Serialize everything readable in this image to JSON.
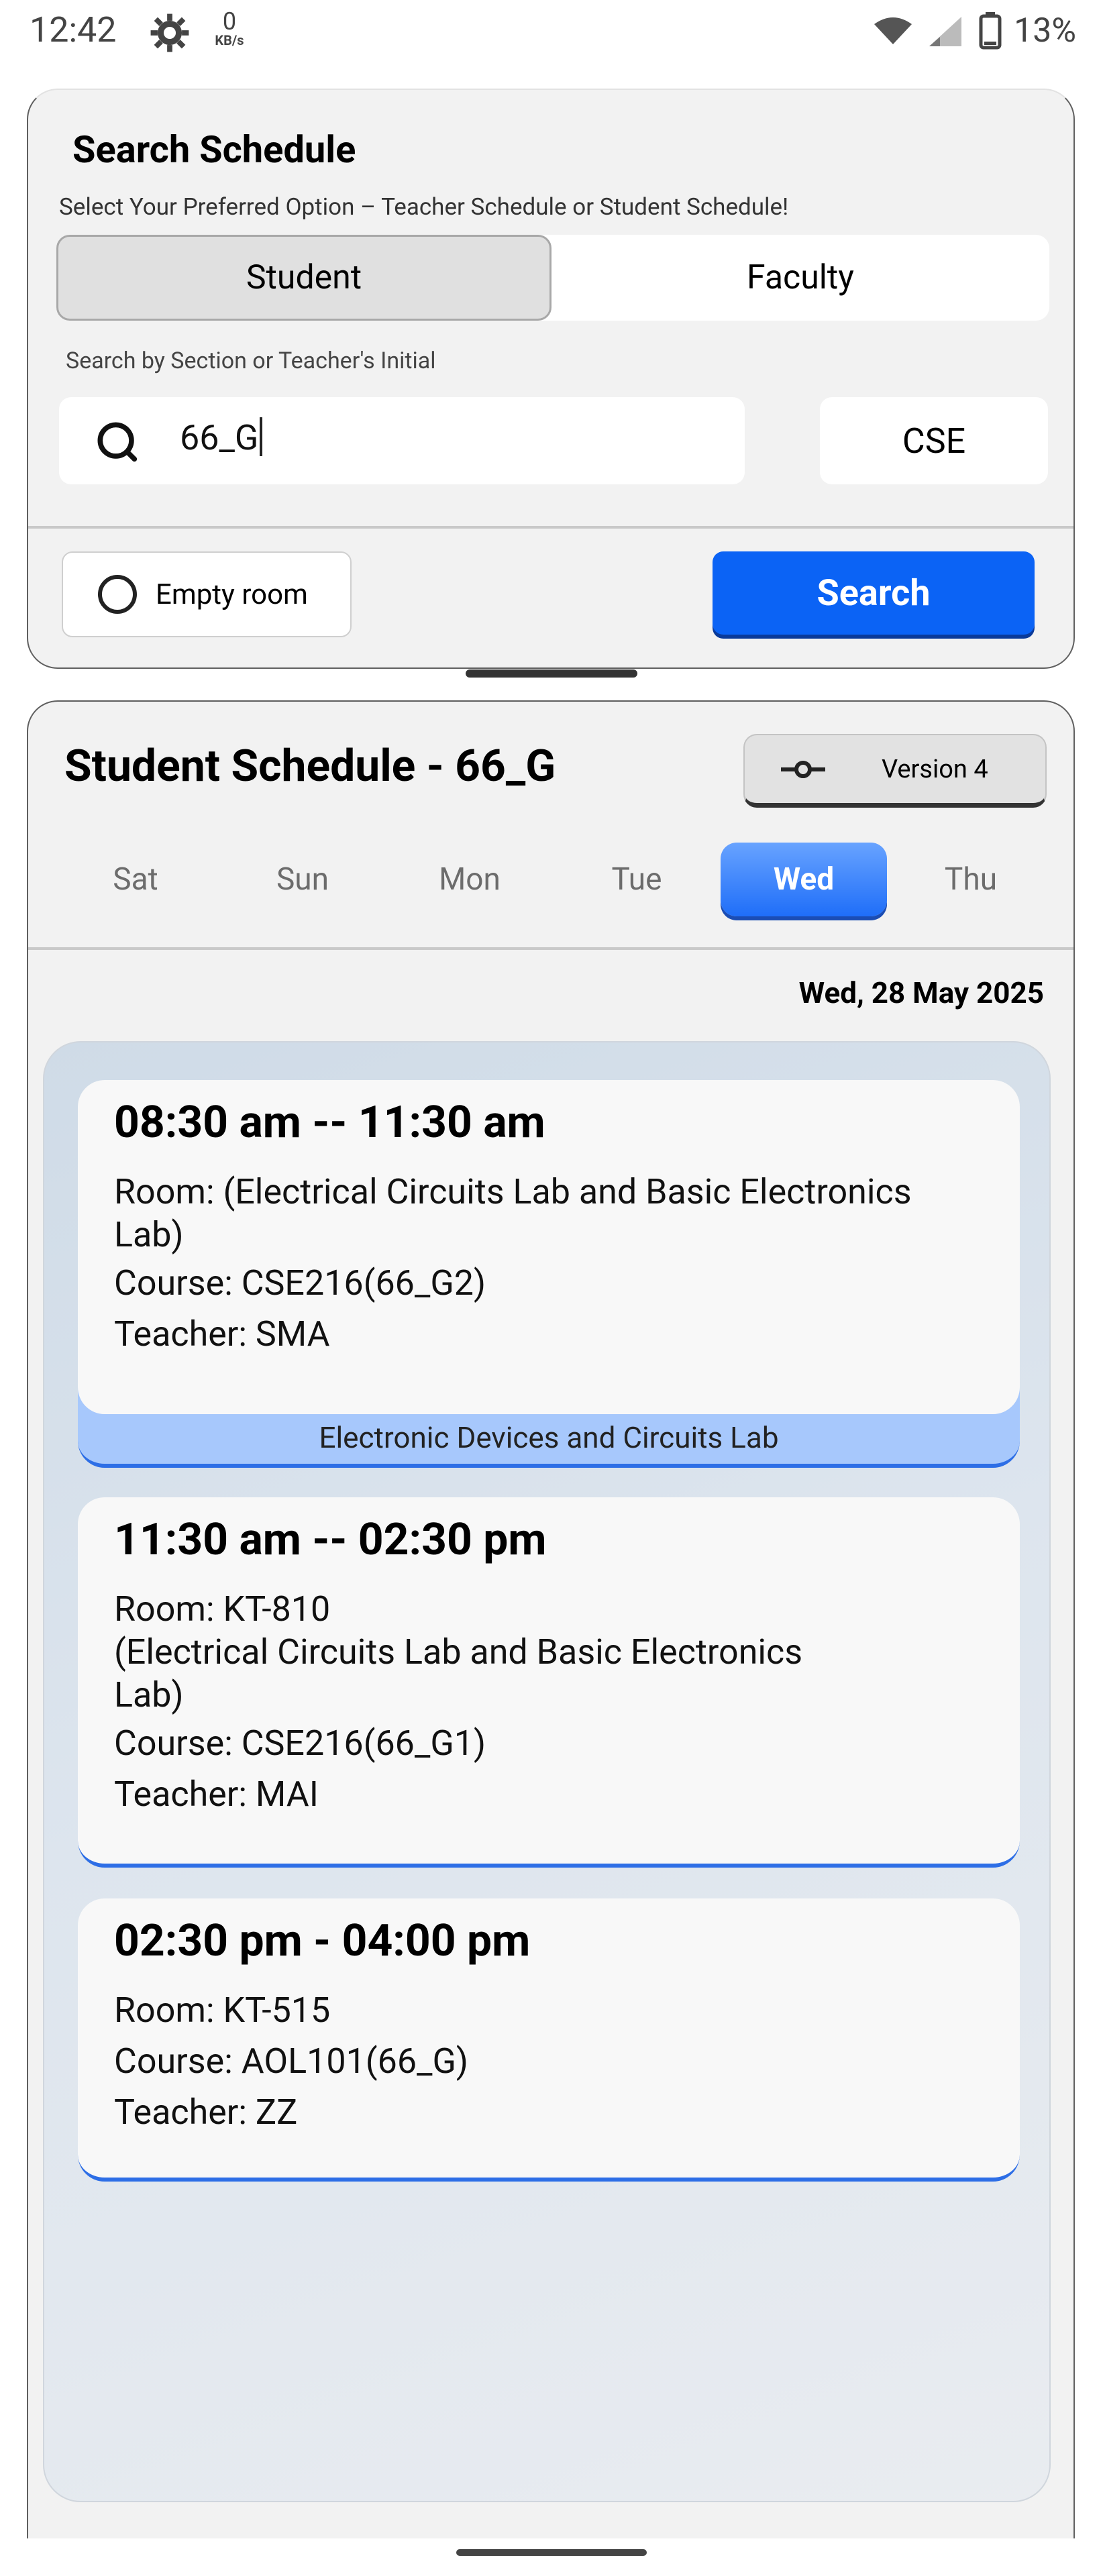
{
  "status_bar": {
    "time": "12:42",
    "net_speed_value": "0",
    "net_speed_unit": "KB/s",
    "battery": "13%",
    "icons": [
      "settings-gear-icon",
      "wifi-icon",
      "signal-icon",
      "battery-icon"
    ]
  },
  "search": {
    "title": "Search Schedule",
    "subtitle": "Select Your Preferred Option – Teacher Schedule or Student Schedule!",
    "toggle_options": [
      "Student",
      "Faculty"
    ],
    "selected_option": "Student",
    "search_label": "Search by Section or Teacher's Initial",
    "search_value": "66_G",
    "department": "CSE",
    "empty_room_label": "Empty room",
    "search_button": "Search"
  },
  "schedule": {
    "title": "Student Schedule - 66_G",
    "version_label": "Version 4",
    "days": [
      "Sat",
      "Sun",
      "Mon",
      "Tue",
      "Wed",
      "Thu"
    ],
    "active_day": "Wed",
    "date": "Wed, 28 May 2025",
    "classes": [
      {
        "time": "08:30 am -- 11:30 am",
        "room": "Room: (Electrical Circuits Lab and Basic Electronics Lab)",
        "course": "Course: CSE216(66_G2)",
        "teacher": "Teacher: SMA",
        "footer": "Electronic Devices and Circuits Lab"
      },
      {
        "time": "11:30 am -- 02:30 pm",
        "room_line1": "Room: KT-810",
        "room_line2": "(Electrical Circuits Lab and Basic Electronics Lab)",
        "course": "Course: CSE216(66_G1)",
        "teacher": "Teacher: MAI"
      },
      {
        "time": "02:30 pm - 04:00 pm",
        "room": "Room: KT-515",
        "course": "Course: AOL101(66_G)",
        "teacher": "Teacher: ZZ"
      }
    ]
  },
  "colors": {
    "accent": "#0b63f5",
    "active_day": "#1f6ef8",
    "card_footer": "#a7c8fc",
    "card_background": "#f2f2f2"
  }
}
